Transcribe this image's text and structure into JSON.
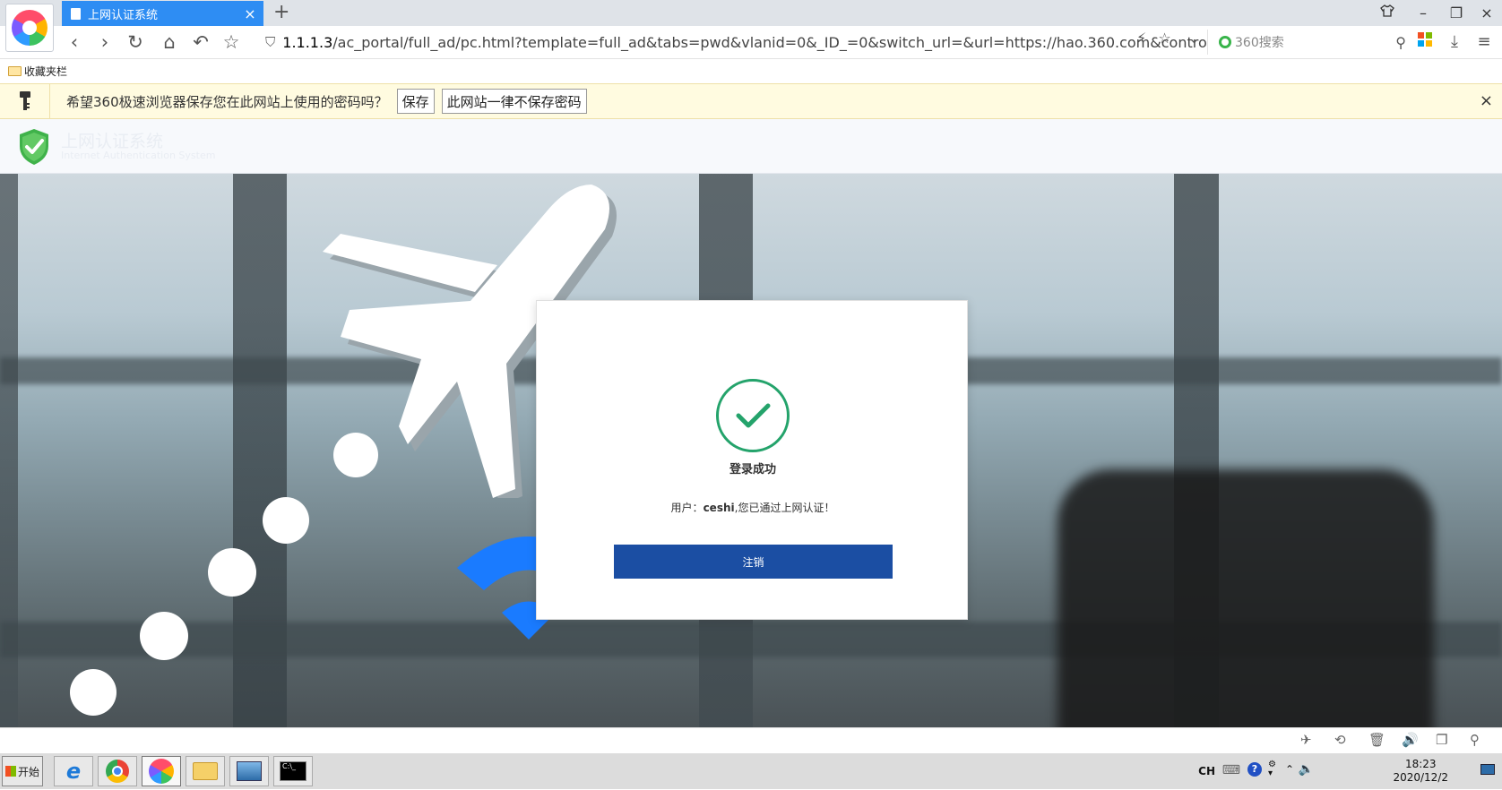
{
  "browser": {
    "tab": {
      "title": "上网认证系统",
      "close": "×"
    },
    "new_tab": "+",
    "window_controls": {
      "skin": "skin-icon",
      "minimize": "–",
      "restore": "❐",
      "close": "×"
    },
    "nav": {
      "back": "‹",
      "forward": "›",
      "reload": "↻",
      "home": "⌂",
      "undo": "↶",
      "favorite": "☆"
    },
    "url_host": "1.1.1.3",
    "url_rest": "/ac_portal/full_ad/pc.html?template=full_ad&tabs=pwd&vlanid=0&_ID_=0&switch_url=&url=https://hao.360.com&contro",
    "search": {
      "placeholder": "360搜索"
    },
    "bookmarks_label": "收藏夹栏"
  },
  "password_bar": {
    "message": "希望360极速浏览器保存您在此网站上使用的密码吗？",
    "save_label": "保存",
    "never_label": "此网站一律不保存密码",
    "close": "×"
  },
  "portal": {
    "title": "上网认证系统",
    "subtitle": "Internet Authentication System"
  },
  "card": {
    "title": "登录成功",
    "msg_prefix": "用户：",
    "username": "ceshi",
    "msg_suffix": ",您已通过上网认证！",
    "logout_label": "注销"
  },
  "taskbar": {
    "start_label": "开始",
    "lang": "CH",
    "time": "18:23",
    "date": "2020/12/2"
  },
  "colors": {
    "tab_active": "#2e8df3",
    "success_green": "#24a36b",
    "logout_blue": "#1b4ea3",
    "pw_bar_bg": "#fffbe0"
  }
}
